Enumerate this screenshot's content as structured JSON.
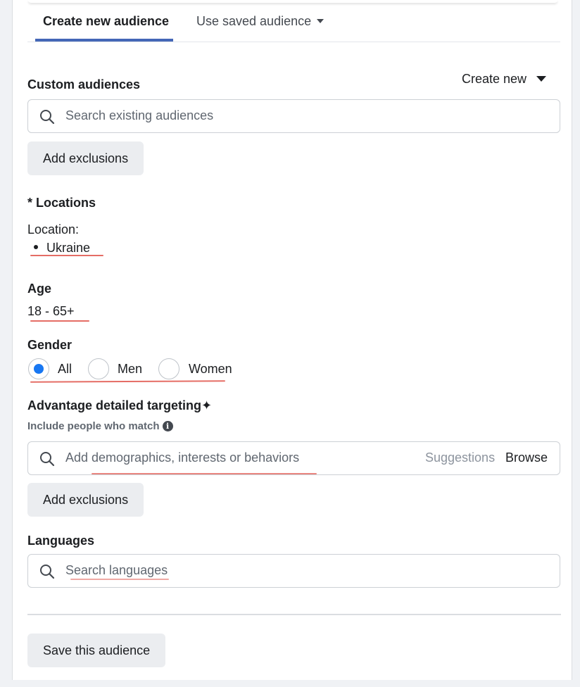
{
  "tabs": {
    "active": "Create new audience",
    "inactive": "Use saved audience"
  },
  "custom_audiences": {
    "label": "Custom audiences",
    "create_new": "Create new",
    "search_placeholder": "Search existing audiences",
    "exclusions_button": "Add exclusions"
  },
  "locations": {
    "label": "* Locations",
    "location_label": "Location:",
    "items": [
      "Ukraine"
    ]
  },
  "age": {
    "label": "Age",
    "value": "18 - 65+"
  },
  "gender": {
    "label": "Gender",
    "options": [
      "All",
      "Men",
      "Women"
    ],
    "selected": "All"
  },
  "detailed_targeting": {
    "label": "Advantage detailed targeting",
    "sparkle": "✦",
    "sublabel": "Include people who match",
    "search_placeholder": "Add demographics, interests or behaviors",
    "suggestions": "Suggestions",
    "browse": "Browse",
    "exclusions_button": "Add exclusions"
  },
  "languages": {
    "label": "Languages",
    "search_placeholder": "Search languages"
  },
  "save_button": "Save this audience",
  "colors": {
    "accent": "#1877f2",
    "tab_underline": "#4467b7",
    "annotation": "#e0534a"
  }
}
